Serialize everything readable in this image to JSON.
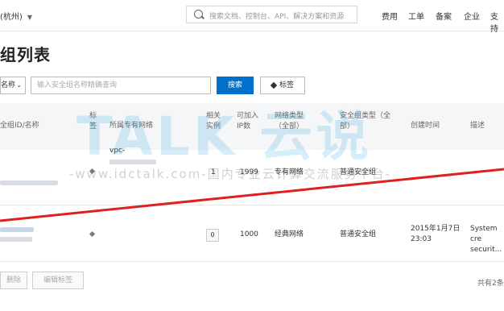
{
  "topbar": {
    "region": "(杭州)",
    "search_placeholder": "搜索文档、控制台、API、解决方案和资源",
    "nav": [
      "费用",
      "工单",
      "备案",
      "企业",
      "支持"
    ]
  },
  "page": {
    "title": "组列表"
  },
  "filter": {
    "select_value": "名称",
    "input_placeholder": "输入安全组名称精确查询",
    "search_label": "搜索",
    "tag_label": "标签"
  },
  "table": {
    "headers": {
      "id": "全组ID/名称",
      "tag": "标签",
      "vpc": "所属专有网络",
      "instances": "相关实例",
      "capacity": "可加入IP数",
      "network": "网络类型（全部）",
      "sg_type": "安全组类型（全部）",
      "created": "创建时间",
      "desc": "描述"
    },
    "rows": [
      {
        "vpc": "vpc-",
        "instances": "1",
        "capacity": "1999",
        "network": "专有网络",
        "sg_type": "普通安全组",
        "created": "",
        "desc": ""
      },
      {
        "vpc": "",
        "instances": "0",
        "capacity": "1000",
        "network": "经典网络",
        "sg_type": "普通安全组",
        "created": "2015年1月7日 23:03",
        "desc": "System cre securit..."
      }
    ]
  },
  "footer": {
    "delete_label": "删除",
    "edit_tags_label": "编辑标签",
    "total": "共有2条"
  },
  "watermark": {
    "logo_text": "TALK 云说",
    "site_text": "-www.idctalk.com-国内专业云计算交流服务平台-"
  }
}
